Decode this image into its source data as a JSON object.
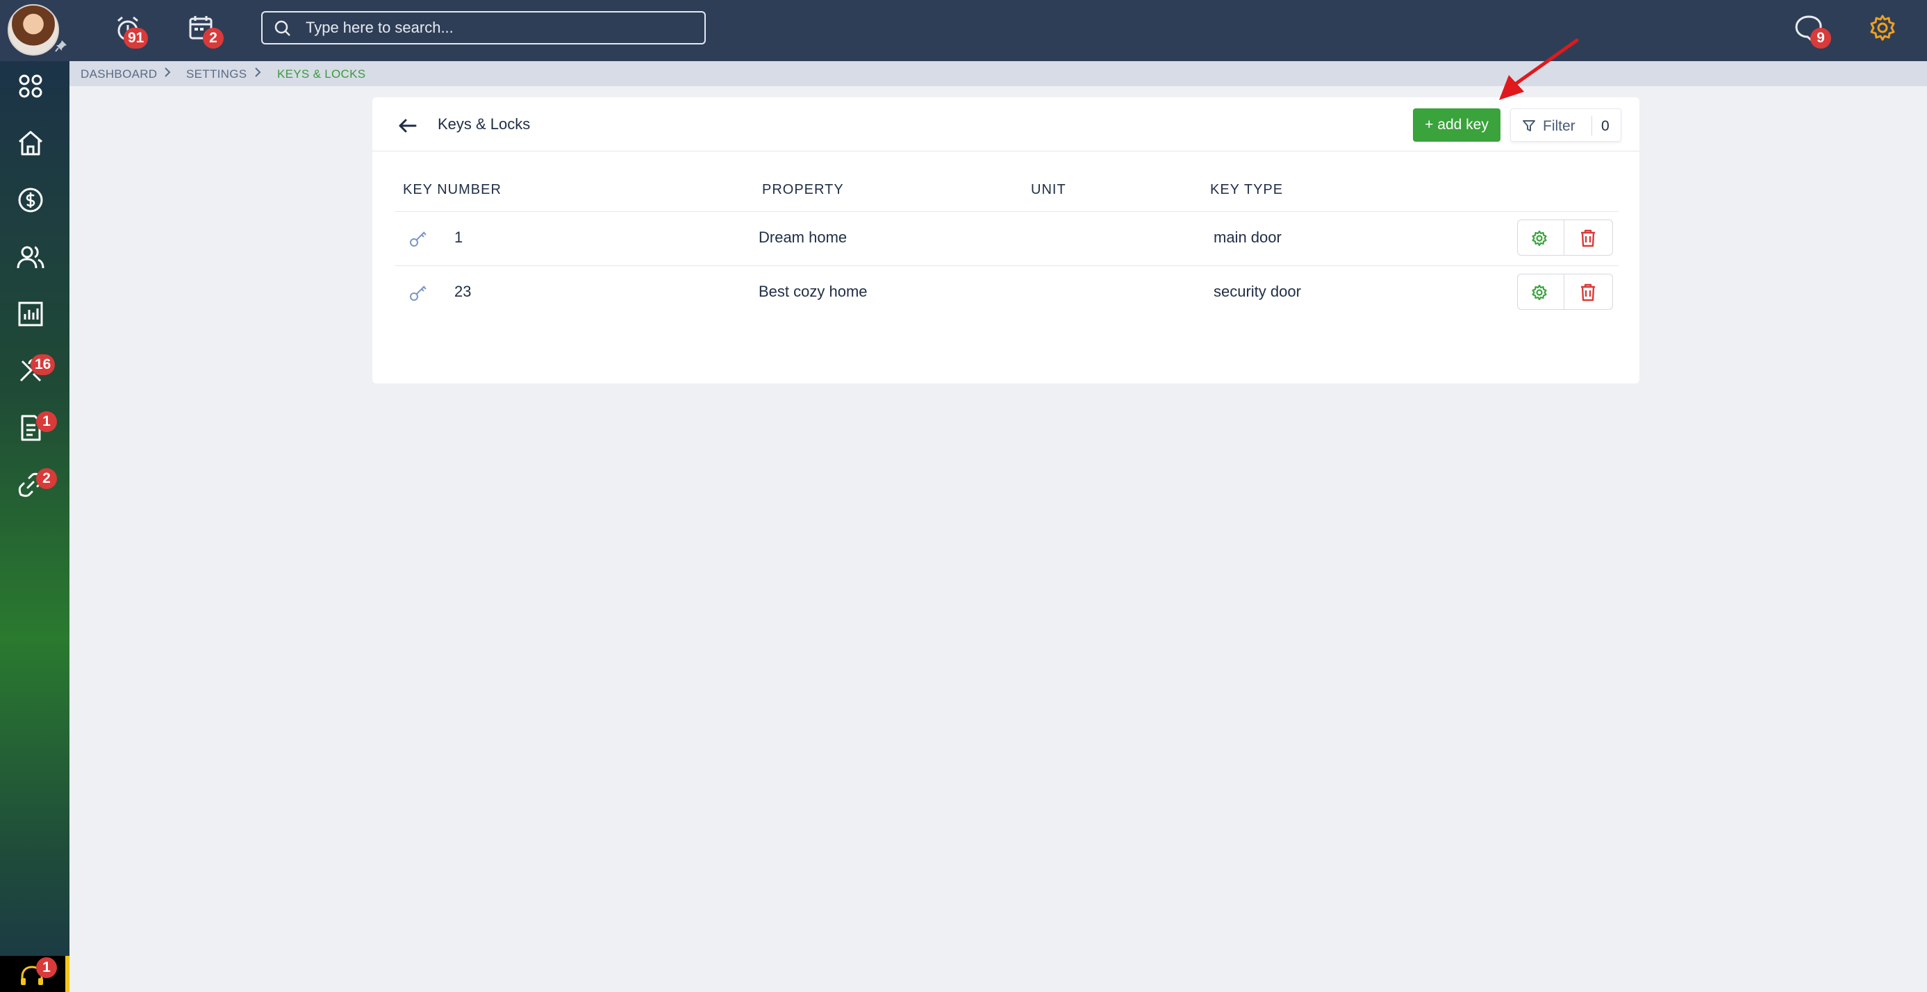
{
  "topbar": {
    "alarm_badge": "91",
    "calendar_badge": "2",
    "search_placeholder": "Type here to search...",
    "chat_badge": "9"
  },
  "sidebar": {
    "items": [
      {
        "icon": "apps-grid-icon",
        "badge": ""
      },
      {
        "icon": "home-icon",
        "badge": ""
      },
      {
        "icon": "dollar-icon",
        "badge": ""
      },
      {
        "icon": "users-icon",
        "badge": ""
      },
      {
        "icon": "chart-icon",
        "badge": ""
      },
      {
        "icon": "tools-icon",
        "badge": "16"
      },
      {
        "icon": "document-icon",
        "badge": "1"
      },
      {
        "icon": "link-icon",
        "badge": "2"
      }
    ],
    "support_badge": "1"
  },
  "breadcrumb": {
    "items": [
      "DASHBOARD",
      "SETTINGS",
      "KEYS & LOCKS"
    ]
  },
  "card": {
    "title": "Keys & Locks",
    "add_label": "+ add key",
    "filter_label": "Filter",
    "filter_count": "0"
  },
  "table": {
    "headers": [
      "KEY NUMBER",
      "PROPERTY",
      "UNIT",
      "KEY TYPE"
    ],
    "rows": [
      {
        "key_number": "1",
        "property": "Dream home",
        "unit": "",
        "key_type": "main door"
      },
      {
        "key_number": "23",
        "property": "Best cozy home",
        "unit": "",
        "key_type": "security door"
      }
    ]
  },
  "colors": {
    "topbar": "#2f3e57",
    "accent_green": "#3aa33c",
    "danger_red": "#d93a3a",
    "settings_orange": "#f0a11c"
  }
}
